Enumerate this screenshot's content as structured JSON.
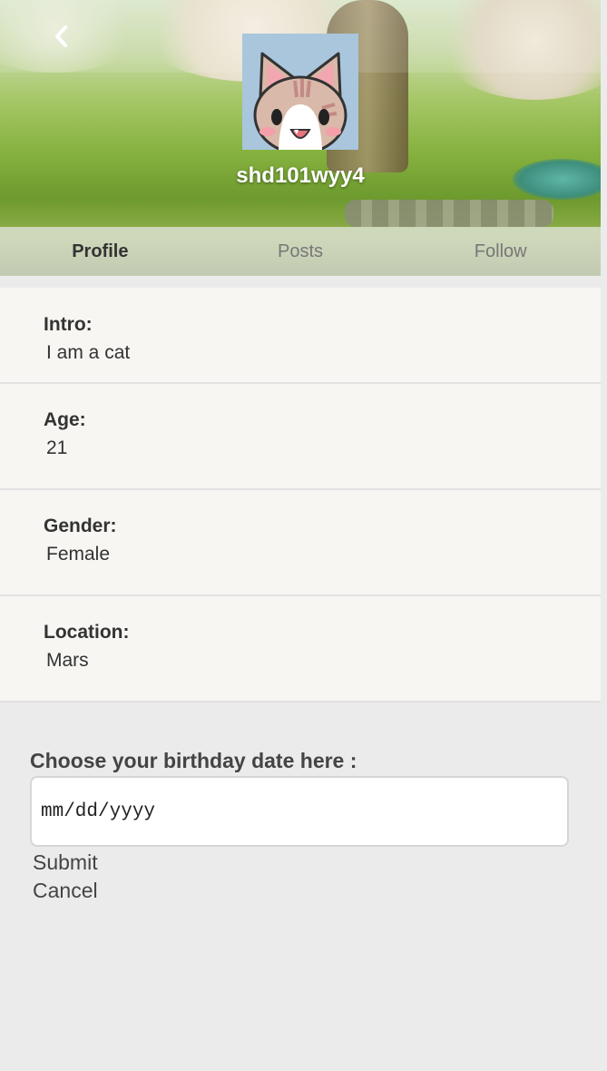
{
  "header": {
    "username": "shd101wyy4",
    "back_icon": "chevron-left-icon",
    "avatar_icon": "cat-avatar-icon"
  },
  "tabs": [
    {
      "label": "Profile",
      "active": true
    },
    {
      "label": "Posts",
      "active": false
    },
    {
      "label": "Follow",
      "active": false
    }
  ],
  "profile": {
    "intro": {
      "label": "Intro:",
      "value": "I am a cat"
    },
    "age": {
      "label": "Age:",
      "value": "21"
    },
    "gender": {
      "label": "Gender:",
      "value": "Female"
    },
    "location": {
      "label": "Location:",
      "value": "Mars"
    }
  },
  "birthday_form": {
    "label": "Choose your birthday date here :",
    "date_placeholder": "mm/dd/yyyy",
    "submit_label": "Submit",
    "cancel_label": "Cancel"
  },
  "colors": {
    "page_background": "#ebebeb",
    "info_background": "#f7f6f3",
    "avatar_background": "#a9c6dd",
    "text": "#333333"
  }
}
